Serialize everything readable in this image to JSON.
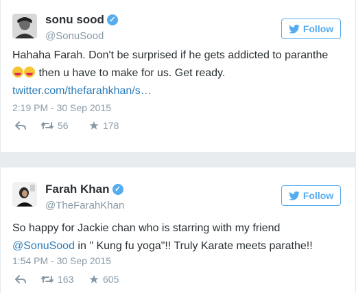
{
  "tweets": [
    {
      "name": "sonu sood",
      "handle": "@SonuSood",
      "follow_label": "Follow",
      "text_before": "Hahaha Farah. Don't be surprised if he gets addicted to paranthe",
      "text_after": " then u have to make for us. Get ready.",
      "link": "twitter.com/thefarahkhan/s…",
      "timestamp": "2:19 PM - 30 Sep 2015",
      "retweets": "56",
      "favorites": "178",
      "verified": true
    },
    {
      "name": "Farah Khan",
      "handle": "@TheFarahKhan",
      "follow_label": "Follow",
      "text_line1": "So happy for Jackie chan who is starring with my friend",
      "mention": "@SonuSood",
      "text_line2": " in \" Kung fu yoga\"!! Truly Karate meets parathe!!",
      "timestamp": "1:54 PM - 30 Sep 2015",
      "retweets": "163",
      "favorites": "605",
      "verified": true
    }
  ],
  "colors": {
    "accent": "#55acee",
    "link": "#2b7bb9",
    "muted": "#8899a6"
  }
}
